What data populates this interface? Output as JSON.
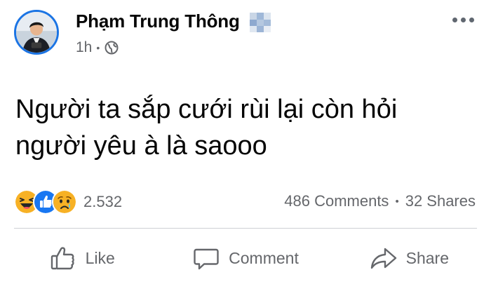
{
  "post": {
    "author": "Phạm Trung Thông",
    "time": "1h",
    "meta_separator": "•",
    "text": "Người ta sắp cưới rùi lại còn hỏi người yêu à là saooo",
    "reaction_count": "2.532",
    "comments": "486 Comments",
    "shares": "32 Shares",
    "stats_separator": "•"
  },
  "reactions": [
    "haha-icon",
    "like-icon",
    "sad-icon"
  ],
  "actions": {
    "like": "Like",
    "comment": "Comment",
    "share": "Share"
  },
  "icons": {
    "privacy": "globe-icon",
    "menu": "more-options-icon"
  },
  "colors": {
    "avatar_ring": "#1b74e4",
    "like_blue": "#1877f2",
    "reaction_yellow": "#f7b125",
    "secondary_text": "#65676b"
  }
}
